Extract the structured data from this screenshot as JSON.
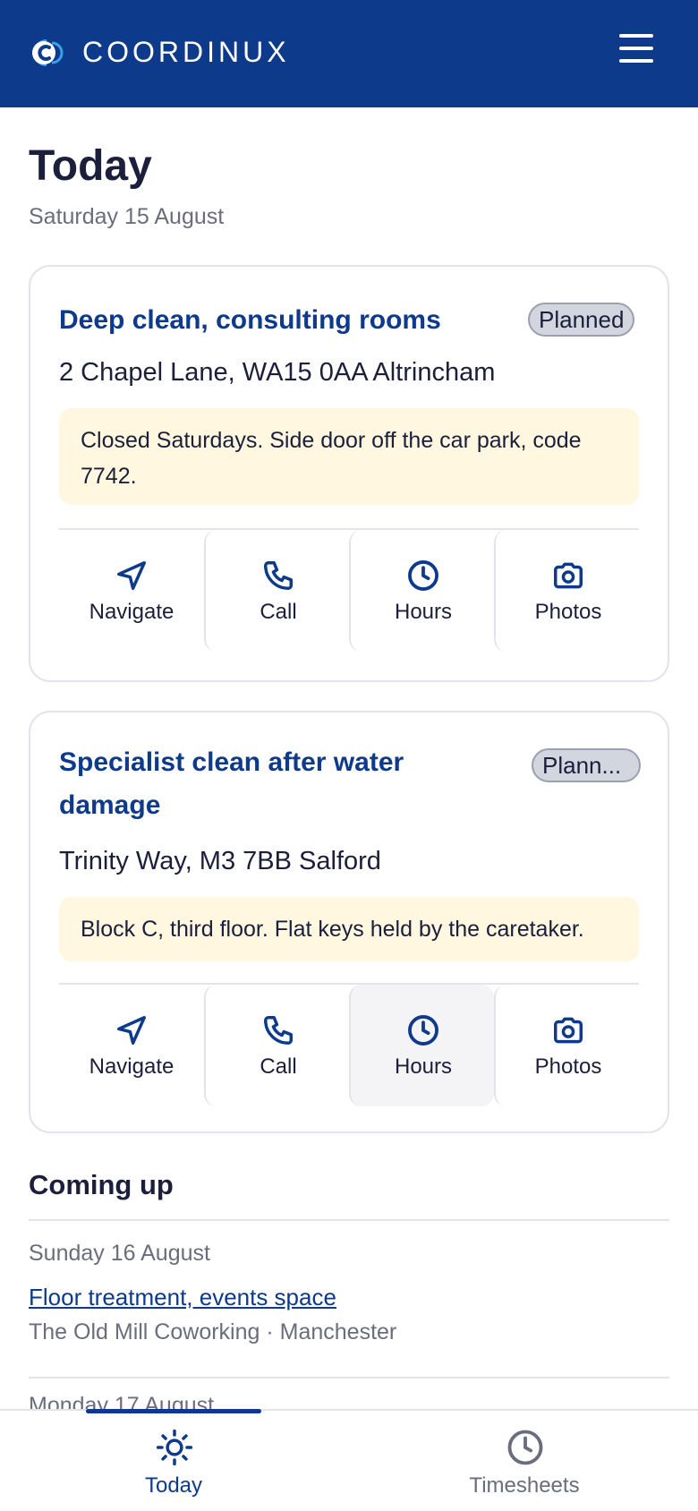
{
  "header": {
    "brand": "COORDINUX",
    "logo_icon": "coordinux-logo-icon",
    "menu_icon": "hamburger-menu-icon"
  },
  "page": {
    "title": "Today",
    "date": "Saturday 15 August"
  },
  "jobs": [
    {
      "title": "Deep clean, consulting rooms",
      "status": "Planned",
      "address": "2 Chapel Lane, WA15 0AA Altrincham",
      "note": "Closed Saturdays. Side door off the car park, code 7742.",
      "actions": [
        {
          "label": "Navigate",
          "icon": "navigate-icon"
        },
        {
          "label": "Call",
          "icon": "phone-icon"
        },
        {
          "label": "Hours",
          "icon": "clock-icon"
        },
        {
          "label": "Photos",
          "icon": "camera-icon"
        }
      ]
    },
    {
      "title": "Specialist clean after water damage",
      "status": "Plann...",
      "address": "Trinity Way, M3 7BB Salford",
      "note": "Block C, third floor. Flat keys held by the caretaker.",
      "actions": [
        {
          "label": "Navigate",
          "icon": "navigate-icon"
        },
        {
          "label": "Call",
          "icon": "phone-icon"
        },
        {
          "label": "Hours",
          "icon": "clock-icon"
        },
        {
          "label": "Photos",
          "icon": "camera-icon"
        }
      ]
    }
  ],
  "coming_up": {
    "title": "Coming up",
    "items": [
      {
        "date": "Sunday 16 August",
        "title": "Floor treatment, events space",
        "location": "The Old Mill Coworking · Manchester"
      },
      {
        "date": "Monday 17 August"
      }
    ]
  },
  "bottom_nav": [
    {
      "label": "Today",
      "icon": "sun-icon",
      "active": true
    },
    {
      "label": "Timesheets",
      "icon": "clock-icon",
      "active": false
    }
  ],
  "colors": {
    "brand": "#0d3a8a",
    "note_background": "#fff7e0",
    "badge_background": "#d3d6df"
  }
}
